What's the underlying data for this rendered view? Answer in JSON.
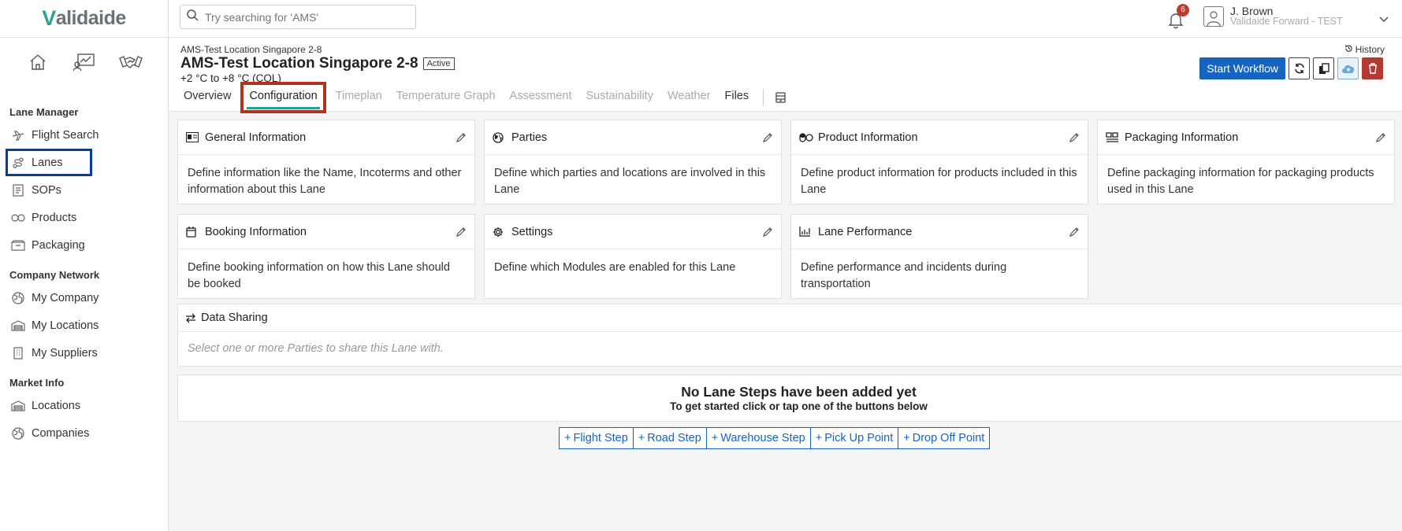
{
  "brand": {
    "logo_v": "V",
    "logo_rest": "alidaide"
  },
  "search": {
    "placeholder": "Try searching for 'AMS'"
  },
  "notifications": {
    "count": "6"
  },
  "user": {
    "name": "J. Brown",
    "org": "Validaide Forward - TEST"
  },
  "sidebar": {
    "quick_icons": [
      "home-icon",
      "dashboard-icon",
      "handshake-icon"
    ],
    "sections": [
      {
        "title": "Lane Manager",
        "items": [
          "Flight Search",
          "Lanes",
          "SOPs",
          "Products",
          "Packaging"
        ]
      },
      {
        "title": "Company Network",
        "items": [
          "My Company",
          "My Locations",
          "My Suppliers"
        ]
      },
      {
        "title": "Market Info",
        "items": [
          "Locations",
          "Companies"
        ]
      }
    ]
  },
  "header": {
    "breadcrumb": "AMS-Test Location Singapore 2-8",
    "history_label": "History",
    "title": "AMS-Test Location Singapore 2-8",
    "status": "Active",
    "temperature": "+2 °C to +8 °C (COL)",
    "start_workflow": "Start Workflow"
  },
  "tabs": [
    {
      "label": "Overview",
      "state": "enabled"
    },
    {
      "label": "Configuration",
      "state": "active"
    },
    {
      "label": "Timeplan",
      "state": "disabled"
    },
    {
      "label": "Temperature Graph",
      "state": "disabled"
    },
    {
      "label": "Assessment",
      "state": "disabled"
    },
    {
      "label": "Sustainability",
      "state": "disabled"
    },
    {
      "label": "Weather",
      "state": "disabled"
    },
    {
      "label": "Files",
      "state": "enabled"
    }
  ],
  "cards": [
    {
      "title": "General Information",
      "body": "Define information like the Name, Incoterms and other information about this Lane"
    },
    {
      "title": "Parties",
      "body": "Define which parties and locations are involved in this Lane"
    },
    {
      "title": "Product Information",
      "body": "Define product information for products included in this Lane"
    },
    {
      "title": "Packaging Information",
      "body": "Define packaging information for packaging products used in this Lane"
    },
    {
      "title": "Booking Information",
      "body": "Define booking information on how this Lane should be booked"
    },
    {
      "title": "Settings",
      "body": "Define which Modules are enabled for this Lane"
    },
    {
      "title": "Lane Performance",
      "body": "Define performance and incidents during transportation"
    }
  ],
  "data_sharing": {
    "title": "Data Sharing",
    "placeholder": "Select one or more Parties to share this Lane with."
  },
  "lane_steps": {
    "empty_title": "No Lane Steps have been added yet",
    "empty_subtitle": "To get started click or tap one of the buttons below",
    "buttons": [
      "Flight Step",
      "Road Step",
      "Warehouse Step",
      "Pick Up Point",
      "Drop Off Point"
    ]
  },
  "colors": {
    "primary": "#1565c0",
    "accent": "#2aa198",
    "danger": "#b23b34",
    "lanes_highlight": "#0a3aa8",
    "config_highlight": "#b3341c"
  }
}
